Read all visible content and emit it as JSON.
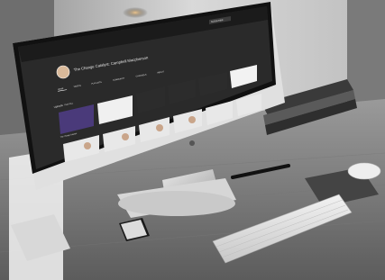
{
  "scene": {
    "description_items": [
      "computer-monitor",
      "keyboard",
      "mouse",
      "stylus-pen",
      "smartphone",
      "stack-of-books",
      "notepad",
      "desk"
    ],
    "colors": {
      "desk": "#8a8a8a",
      "desk_dark": "#4a4a4a",
      "wall": "#cfcfcf",
      "monitor_bezel": "#111111",
      "screen_bg": "#2a2a2a",
      "banner": "#1b1b1b"
    }
  },
  "screen": {
    "channel_title": "The Change Catalyst: Campbell Macpherson",
    "channel_subtitle": "",
    "tabs": [
      "HOME",
      "VIDEOS",
      "PLAYLISTS",
      "COMMUNITY",
      "CHANNELS",
      "ABOUT"
    ],
    "subscribe_label": "SUBSCRIBE",
    "section_title": "Uploads",
    "section_action": "PLAY ALL",
    "row1_titles": [
      "The Change Catalyst",
      "",
      "",
      "",
      "",
      ""
    ],
    "row2_titles": [
      "Change Catalyst",
      "",
      "",
      "",
      "",
      ""
    ]
  }
}
